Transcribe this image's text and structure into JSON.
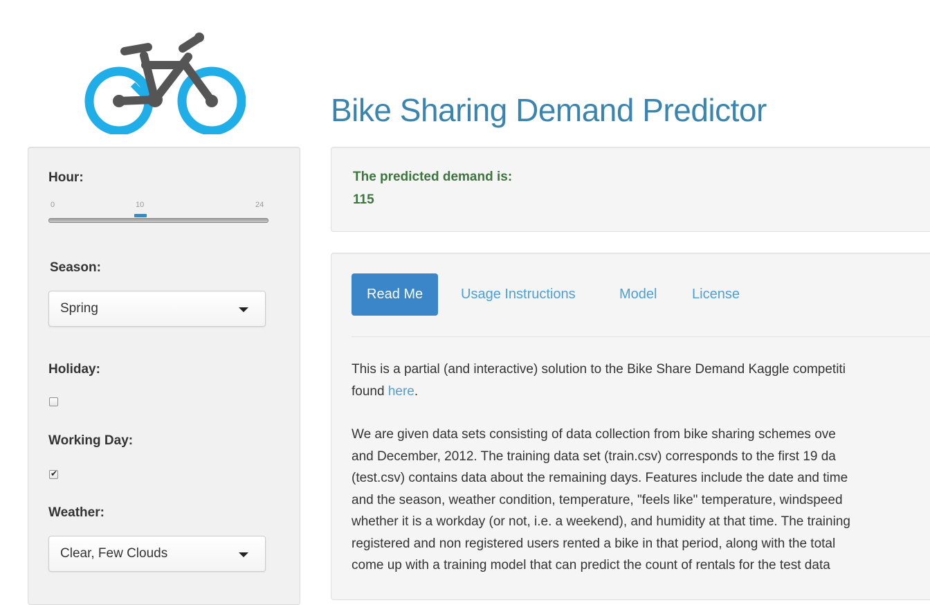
{
  "header": {
    "title": "Bike Sharing Demand Predictor",
    "logo_icon": "bicycle-icon",
    "colors": {
      "logo_wheel": "#1faee8",
      "logo_frame": "#555555",
      "title": "#3a84b0"
    }
  },
  "sidebar": {
    "hour": {
      "label": "Hour:",
      "min": "0",
      "max": "24",
      "value": "10",
      "fraction": 0.417
    },
    "season": {
      "label": "Season:",
      "selected": "Spring"
    },
    "holiday": {
      "label": "Holiday:",
      "checked": false
    },
    "working_day": {
      "label": "Working Day:",
      "checked": true
    },
    "weather": {
      "label": "Weather:",
      "selected": "Clear, Few Clouds"
    }
  },
  "prediction": {
    "label": "The predicted demand is:",
    "value": "115",
    "color": "#3c763d"
  },
  "tabs": [
    {
      "label": "Read Me",
      "active": true
    },
    {
      "label": "Usage Instructions",
      "active": false
    },
    {
      "label": "Model",
      "active": false
    },
    {
      "label": "License",
      "active": false
    }
  ],
  "readme": {
    "p1_line1": "This is a partial (and interactive) solution to the Bike Share Demand Kaggle competiti",
    "p1_line2_prefix": "found ",
    "p1_link": "here",
    "p1_line2_suffix": ".",
    "p2_lines": [
      "We are given data sets consisting of data collection from bike sharing schemes ove",
      "and December, 2012. The training data set (train.csv) corresponds to the first 19 da",
      "(test.csv) contains data about the remaining days. Features include the date and time",
      "and the season, weather condition, temperature, \"feels like\" temperature, windspeed",
      "whether it is a workday (or not, i.e. a weekend), and humidity at that time. The training",
      "registered and non registered users rented a bike in that period, along with the total",
      "come up with a training model that can predict the count of rentals for the test data"
    ]
  }
}
